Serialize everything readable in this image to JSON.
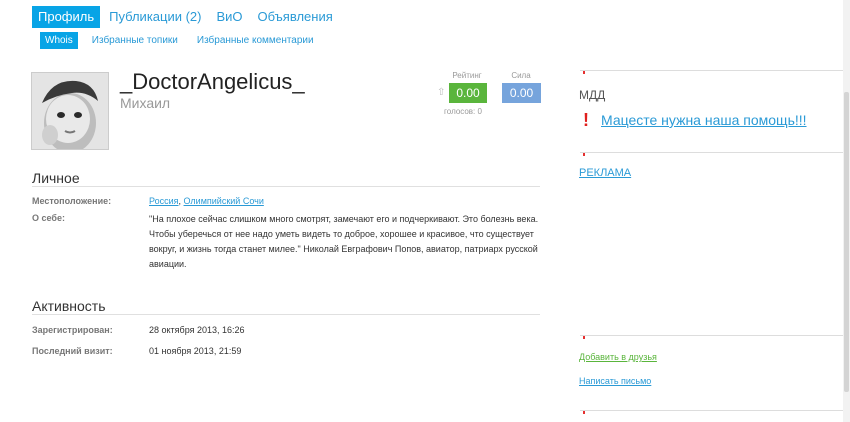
{
  "tabs": [
    {
      "label": "Профиль",
      "active": true
    },
    {
      "label": "Публикации (2)",
      "active": false
    },
    {
      "label": "ВиО",
      "active": false
    },
    {
      "label": "Объявления",
      "active": false
    }
  ],
  "subtabs": [
    {
      "label": "Whois",
      "active": true
    },
    {
      "label": "Избранные топики",
      "active": false
    },
    {
      "label": "Избранные комментарии",
      "active": false
    }
  ],
  "profile": {
    "login": "_DoctorAngelicus_",
    "name": "Михаил",
    "rating_label": "Рейтинг",
    "rating_value": "0.00",
    "votes": "голосов: 0",
    "power_label": "Сила",
    "power_value": "0.00"
  },
  "personal": {
    "title": "Личное",
    "location_label": "Местоположение:",
    "location_country": "Россия",
    "location_city": "Олимпийский Сочи",
    "about_label": "О себе:",
    "about_text": "\"На плохое сейчас слишком много смотрят, замечают его и подчеркивают. Это болезнь века. Чтобы уберечься от нее надо уметь видеть то доброе, хорошее и красивое, что существует вокруг, и жизнь тогда станет милее.\" Николай Евграфович Попов, авиатор, патриарх русской авиации."
  },
  "activity": {
    "title": "Активность",
    "registered_label": "Зарегистрирован:",
    "registered_value": "28 октября 2013, 16:26",
    "last_visit_label": "Последний визит:",
    "last_visit_value": "01 ноября 2013, 21:59"
  },
  "sidebar": {
    "mdd_title": "МДД",
    "mdd_link": "Мацесте нужна наша помощь!!!",
    "ad_link": "РЕКЛАМА",
    "add_friend": "Добавить в друзья",
    "write_message": "Написать письмо"
  },
  "colors": {
    "accent": "#08a4e6",
    "rating": "#5ab53c",
    "power": "#76a4dc",
    "alert": "#e0201e"
  }
}
